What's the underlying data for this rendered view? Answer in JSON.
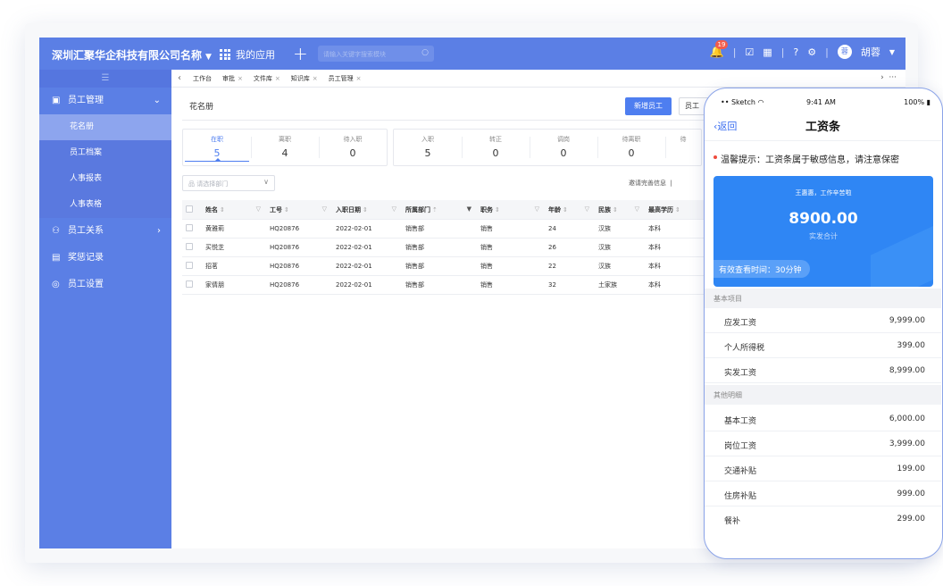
{
  "header": {
    "company": "深圳汇聚华企科技有限公司名称",
    "my_apps": "我的应用",
    "search_placeholder": "请输入关键字搜索模块",
    "notif_count": "19",
    "user": "胡蓉",
    "user_initial": "蓉"
  },
  "sidebar": {
    "items": [
      {
        "label": "员工管理"
      },
      {
        "label": "员工关系"
      },
      {
        "label": "奖惩记录"
      },
      {
        "label": "员工设置"
      }
    ],
    "subitems": [
      {
        "label": "花名册"
      },
      {
        "label": "员工档案"
      },
      {
        "label": "人事报表"
      },
      {
        "label": "人事表格"
      }
    ]
  },
  "tabs": [
    {
      "label": "工作台"
    },
    {
      "label": "审批"
    },
    {
      "label": "文件库"
    },
    {
      "label": "知识库"
    },
    {
      "label": "员工管理"
    }
  ],
  "main": {
    "title": "花名册",
    "new_button": "新增员工",
    "emp_button": "员工",
    "dept_placeholder": "请选择部门",
    "invite": "邀请完善信息",
    "stats_group1": [
      {
        "label": "在职",
        "value": "5"
      },
      {
        "label": "离职",
        "value": "4"
      },
      {
        "label": "待入职",
        "value": "0"
      }
    ],
    "stats_group2": [
      {
        "label": "入职",
        "value": "5"
      },
      {
        "label": "转正",
        "value": "0"
      },
      {
        "label": "调岗",
        "value": "0"
      },
      {
        "label": "待离职",
        "value": "0"
      },
      {
        "label": "待",
        "value": ""
      }
    ],
    "columns": [
      "姓名",
      "工号",
      "入职日期",
      "所属部门",
      "职务",
      "年龄",
      "民族",
      "最高学历"
    ],
    "rows": [
      [
        "黄雅莉",
        "HQ20876",
        "2022-02-01",
        "销售部",
        "销售",
        "24",
        "汉族",
        "本科"
      ],
      [
        "买悦芝",
        "HQ20876",
        "2022-02-01",
        "销售部",
        "销售",
        "26",
        "汉族",
        "本科"
      ],
      [
        "招茗",
        "HQ20876",
        "2022-02-01",
        "销售部",
        "销售",
        "22",
        "汉族",
        "本科"
      ],
      [
        "家倩朋",
        "HQ20876",
        "2022-02-01",
        "销售部",
        "销售",
        "32",
        "土家族",
        "本科"
      ]
    ]
  },
  "phone": {
    "carrier": "•• Sketch",
    "time": "9:41 AM",
    "battery": "100%",
    "back": "返回",
    "title": "工资条",
    "tip": "温馨提示：工资条属于敏感信息，请注意保密",
    "greeting": "王惠惠，工作辛苦啦",
    "amount": "8900.00",
    "amount_label": "实发合计",
    "view_time": "有效查看时间：30分钟",
    "section1": "基本项目",
    "basic": [
      {
        "k": "应发工资",
        "v": "9,999.00"
      },
      {
        "k": "个人所得税",
        "v": "399.00"
      },
      {
        "k": "实发工资",
        "v": "8,999.00"
      }
    ],
    "section2": "其他明细",
    "other": [
      {
        "k": "基本工资",
        "v": "6,000.00"
      },
      {
        "k": "岗位工资",
        "v": "3,999.00"
      },
      {
        "k": "交通补贴",
        "v": "199.00"
      },
      {
        "k": "住房补贴",
        "v": "999.00"
      },
      {
        "k": "餐补",
        "v": "299.00"
      }
    ]
  },
  "colors": {
    "brand": "#5b7fe5",
    "primary_button": "#4e7ef0",
    "salary_card": "#2f86f4"
  }
}
